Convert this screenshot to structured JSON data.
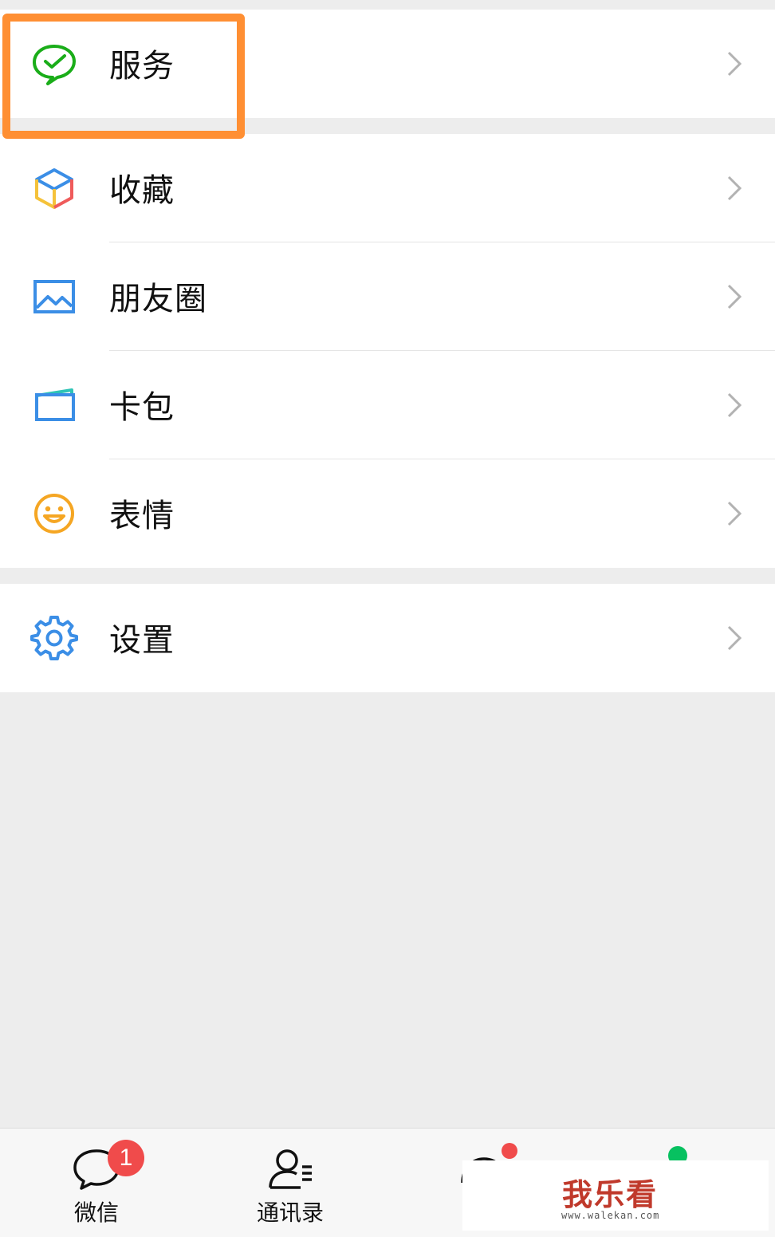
{
  "menu": {
    "service": {
      "label": "服务"
    },
    "favorites": {
      "label": "收藏"
    },
    "moments": {
      "label": "朋友圈"
    },
    "cards": {
      "label": "卡包"
    },
    "stickers": {
      "label": "表情"
    },
    "settings": {
      "label": "设置"
    }
  },
  "tabbar": {
    "chats": {
      "label": "微信",
      "badge": "1"
    },
    "contacts": {
      "label": "通讯录"
    }
  },
  "watermark": {
    "brand": "我乐看",
    "url": "www.walekan.com"
  },
  "colors": {
    "highlight": "#ff8f33",
    "badge": "#f04b4b",
    "wechat_green": "#07c160",
    "chevron": "#b2b2b2"
  }
}
